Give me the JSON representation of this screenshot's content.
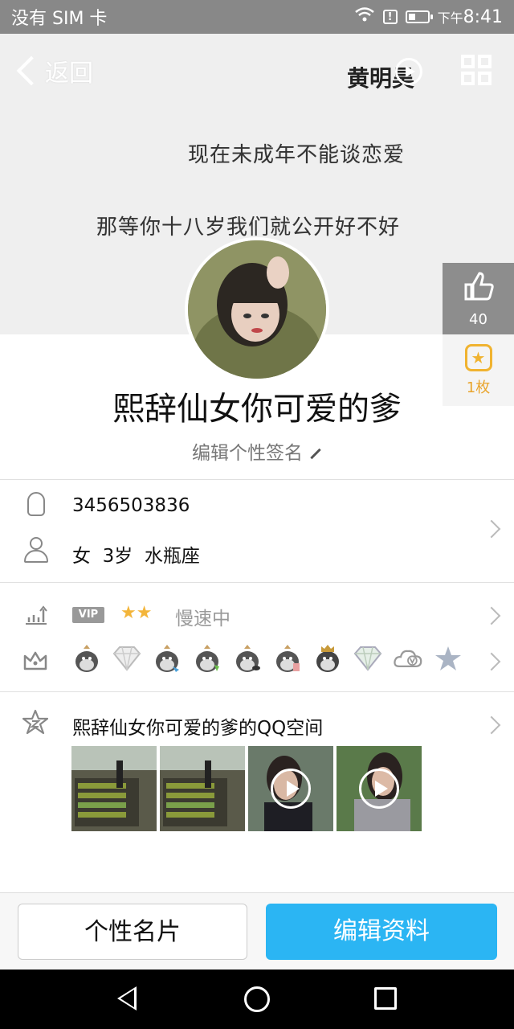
{
  "status_bar": {
    "carrier": "没有 SIM 卡",
    "time_prefix": "下午",
    "time": "8:41"
  },
  "header": {
    "back_label": "返回",
    "music_title": "黄明昊"
  },
  "cover": {
    "line1": "现在未成年不能谈恋爱",
    "line2": "那等你十八岁我们就公开好不好"
  },
  "side": {
    "likes": "40",
    "badge_count": "1枚"
  },
  "profile": {
    "nickname": "熙辞仙女你可爱的爹",
    "signature_placeholder": "编辑个性签名",
    "qq_number": "3456503836",
    "gender": "女",
    "age": "3岁",
    "zodiac": "水瓶座"
  },
  "vip": {
    "tag": "VIP",
    "stars": "★★",
    "status": "慢速中"
  },
  "badges": [
    "penguin-badge",
    "diamond-badge",
    "penguin-blue-badge",
    "penguin-green-badge",
    "penguin-fish-badge",
    "penguin-card-badge",
    "penguin-crown-badge",
    "diamond-green-badge",
    "cloud-v-badge",
    "star-badge"
  ],
  "zone": {
    "title": "熙辞仙女你可爱的爹的QQ空间"
  },
  "actions": {
    "card_label": "个性名片",
    "edit_label": "编辑资料"
  },
  "colors": {
    "accent": "#2bb5f3",
    "status_bar": "#888888",
    "badge_gold": "#f0b330"
  }
}
